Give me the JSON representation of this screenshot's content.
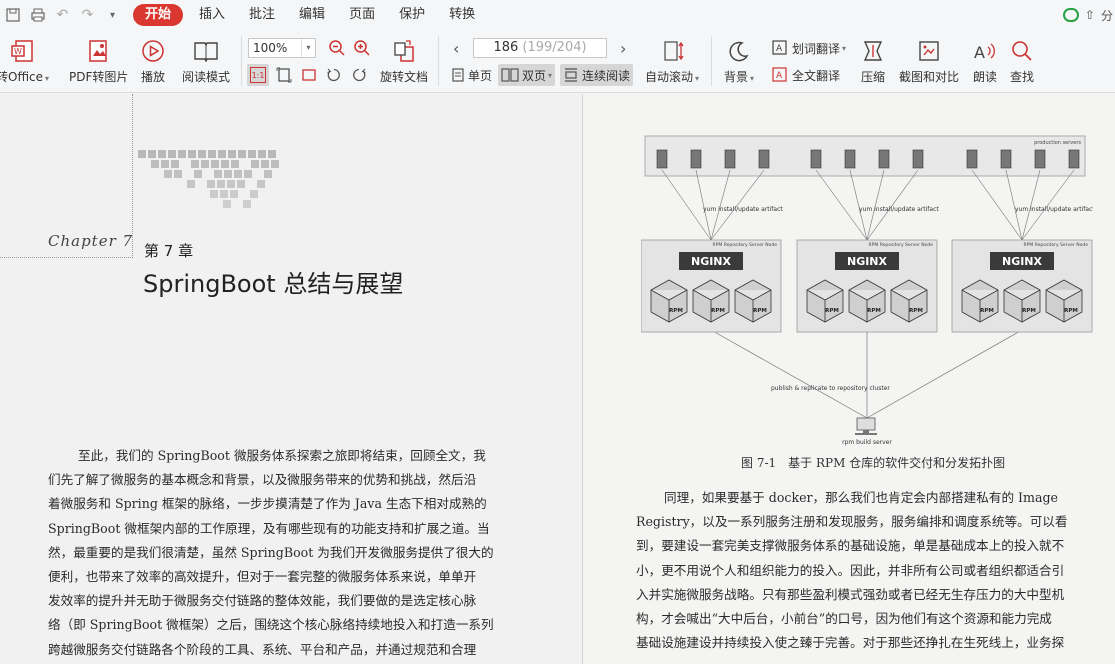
{
  "menubar": {
    "tabs": [
      "开始",
      "插入",
      "批注",
      "编辑",
      "页面",
      "保护",
      "转换"
    ],
    "active": "开始",
    "right_label": "分"
  },
  "toolbar": {
    "to_office": "转Office",
    "pdf_to_image": "PDF转图片",
    "play": "播放",
    "read_mode": "阅读模式",
    "zoom": "100%",
    "rotate": "旋转文档",
    "page_current": "186",
    "page_total": "(199/204)",
    "single_page": "单页",
    "double_page": "双页",
    "continuous": "连续阅读",
    "auto_scroll": "自动滚动",
    "background": "背景",
    "word_translate": "划词翻译",
    "full_translate": "全文翻译",
    "compress": "压缩",
    "screenshot_compare": "截图和对比",
    "read_aloud": "朗读",
    "search": "查找",
    "fit_label": "1:1"
  },
  "left_page": {
    "chapter_script": "Chapter 7",
    "chapter_no": "第 7 章",
    "chapter_title": "SpringBoot 总结与展望",
    "lines": [
      "至此，我们的 SpringBoot 微服务体系探索之旅即将结束，回顾全文，我",
      "们先了解了微服务的基本概念和背景，以及微服务带来的优势和挑战，然后沿",
      "着微服务和 Spring 框架的脉络，一步步摸清楚了作为 Java 生态下相对成熟的",
      "SpringBoot 微框架内部的工作原理，及有哪些现有的功能支持和扩展之道。当",
      "然，最重要的是我们很清楚，虽然 SpringBoot 为我们开发微服务提供了很大的",
      "便利，也带来了效率的高效提升，但对于一套完整的微服务体系来说，单单开",
      "发效率的提升并无助于微服务交付链路的整体效能，我们要做的是选定核心脉",
      "络（即 SpringBoot 微框架）之后，围绕这个核心脉络持续地投入和打造一系列",
      "跨越微服务交付链路各个阶段的工具、系统、平台和产品，并通过规范和合理"
    ]
  },
  "right_page": {
    "figure": {
      "production_label": "production servers",
      "yum_label": "yum install/update artifact",
      "node_label": "RPM Repository Server Node",
      "nginx": "NGINX",
      "rpm": "RPM",
      "publish_label": "publish & replicate to repository cluster",
      "build_label": "rpm build server"
    },
    "caption": "图 7-1　基于 RPM 仓库的软件交付和分发拓扑图",
    "lines": [
      "同理，如果要基于 docker，那么我们也肯定会内部搭建私有的 Image",
      "Registry，以及一系列服务注册和发现服务，服务编排和调度系统等。可以看",
      "到，要建设一套完美支撑微服务体系的基础设施，单是基础成本上的投入就不",
      "小，更不用说个人和组织能力的投入。因此，并非所有公司或者组织都适合引",
      "入并实施微服务战略。只有那些盈利模式强劲或者已经无生存压力的大中型机",
      "构，才会喊出“大中后台，小前台”的口号，因为他们有这个资源和能力完成",
      "基础设施建设并持续投入使之臻于完善。对于那些还挣扎在生死线上，业务探"
    ]
  }
}
